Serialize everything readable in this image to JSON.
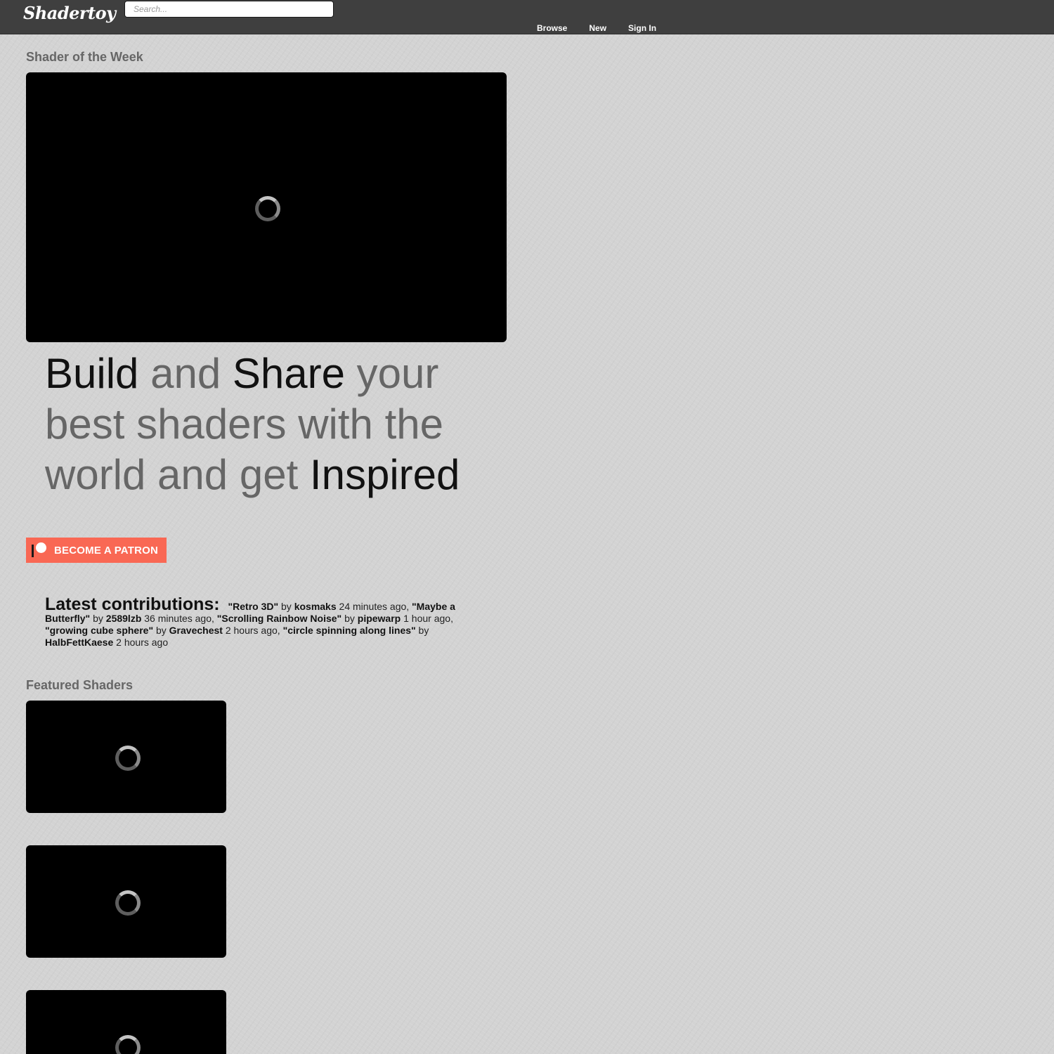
{
  "header": {
    "logo_text": "Shadertoy",
    "search_placeholder": "Search...",
    "nav": [
      {
        "label": "Browse"
      },
      {
        "label": "New"
      },
      {
        "label": "Sign In"
      }
    ]
  },
  "week": {
    "title": "Shader of the Week"
  },
  "tagline": {
    "w1": "Build",
    "w2": " and ",
    "w3": "Share",
    "w4": " your best shaders with the world and get ",
    "w5": "Inspired"
  },
  "patreon": {
    "label": "BECOME A PATRON"
  },
  "latest": {
    "title": "Latest contributions:",
    "by": "by",
    "items": [
      {
        "shader": "\"Retro 3D\"",
        "author": "kosmaks",
        "time": "24 minutes ago"
      },
      {
        "shader": "\"Maybe a Butterfly\"",
        "author": "2589lzb",
        "time": "36 minutes ago"
      },
      {
        "shader": "\"Scrolling Rainbow Noise\"",
        "author": "pipewarp",
        "time": "1 hour ago"
      },
      {
        "shader": "\"growing cube sphere\"",
        "author": "Gravechest",
        "time": "2 hours ago"
      },
      {
        "shader": "\"circle spinning along lines\"",
        "author": "HalbFettKaese",
        "time": "2 hours ago"
      }
    ]
  },
  "featured": {
    "title": "Featured Shaders"
  },
  "colors": {
    "topbar": "#3f3f3f",
    "background": "#d3d3d3",
    "patreon": "#f96854",
    "muted_text": "#666666"
  }
}
